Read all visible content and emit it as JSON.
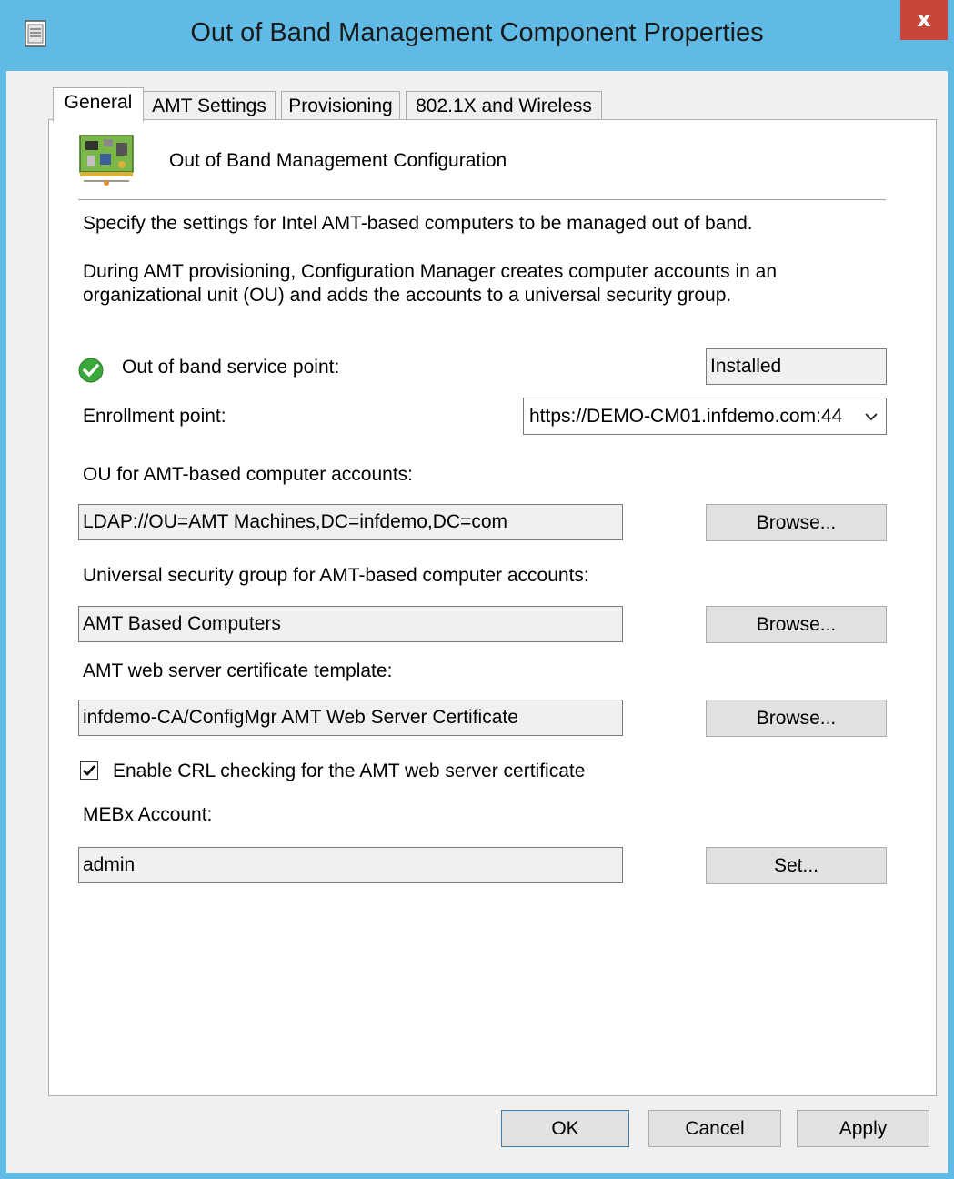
{
  "window": {
    "title": "Out of Band Management Component Properties",
    "close_glyph": "x"
  },
  "tabs": [
    {
      "label": "General",
      "active": true
    },
    {
      "label": "AMT Settings",
      "active": false
    },
    {
      "label": "Provisioning",
      "active": false
    },
    {
      "label": "802.1X and Wireless",
      "active": false
    }
  ],
  "header": {
    "title": "Out of Band Management Configuration",
    "icon": "network-card-icon"
  },
  "description": {
    "line1": "Specify the settings for Intel AMT-based computers to be managed out of band.",
    "line2a": "During AMT provisioning, Configuration Manager creates computer accounts in an",
    "line2b": "organizational unit (OU) and adds the accounts to a universal security group."
  },
  "service_point": {
    "label": "Out of band service point:",
    "status": "Installed",
    "icon": "green-check-icon"
  },
  "enrollment": {
    "label": "Enrollment point:",
    "value": "https://DEMO-CM01.infdemo.com:44"
  },
  "ou": {
    "label": "OU for AMT-based computer accounts:",
    "value": "LDAP://OU=AMT Machines,DC=infdemo,DC=com",
    "button": "Browse..."
  },
  "security_group": {
    "label": "Universal security group for AMT-based computer accounts:",
    "value": "AMT Based Computers",
    "button": "Browse..."
  },
  "cert_template": {
    "label": "AMT web server certificate template:",
    "value": "infdemo-CA/ConfigMgr AMT Web Server Certificate",
    "button": "Browse..."
  },
  "crl": {
    "label": "Enable CRL checking for the AMT web server certificate",
    "checked": true
  },
  "mebx": {
    "label": "MEBx Account:",
    "value": "admin",
    "button": "Set..."
  },
  "footer": {
    "ok": "OK",
    "cancel": "Cancel",
    "apply": "Apply"
  },
  "colors": {
    "titlebar": "#5fbbe6",
    "close": "#c7463b",
    "check_green": "#3aa83a"
  }
}
